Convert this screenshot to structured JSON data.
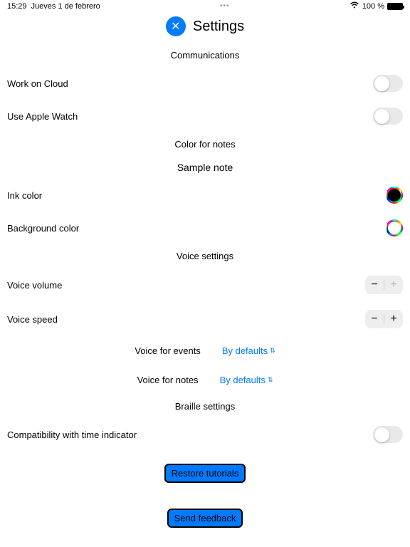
{
  "status": {
    "time": "15:29",
    "date": "Jueves 1 de febrero",
    "battery_pct": "100 %"
  },
  "header": {
    "title": "Settings"
  },
  "sections": {
    "communications": "Communications",
    "color_for_notes": "Color for notes",
    "voice_settings": "Voice settings",
    "braille_settings": "Braille settings"
  },
  "rows": {
    "work_on_cloud": "Work on Cloud",
    "use_apple_watch": "Use Apple Watch",
    "sample_note": "Sample note",
    "ink_color": "Ink color",
    "background_color": "Background color",
    "voice_volume": "Voice volume",
    "voice_speed": "Voice speed",
    "compat_time": "Compatibility with time indicator"
  },
  "pickers": {
    "voice_events_label": "Voice for events",
    "voice_events_value": "By defaults",
    "voice_notes_label": "Voice for notes",
    "voice_notes_value": "By defaults"
  },
  "buttons": {
    "restore_tutorials": "Restore tutorials",
    "send_feedback": "Send feedback"
  },
  "colors": {
    "accent": "#007aff",
    "ink": "#000000",
    "background_swatch": "#ffffff"
  }
}
